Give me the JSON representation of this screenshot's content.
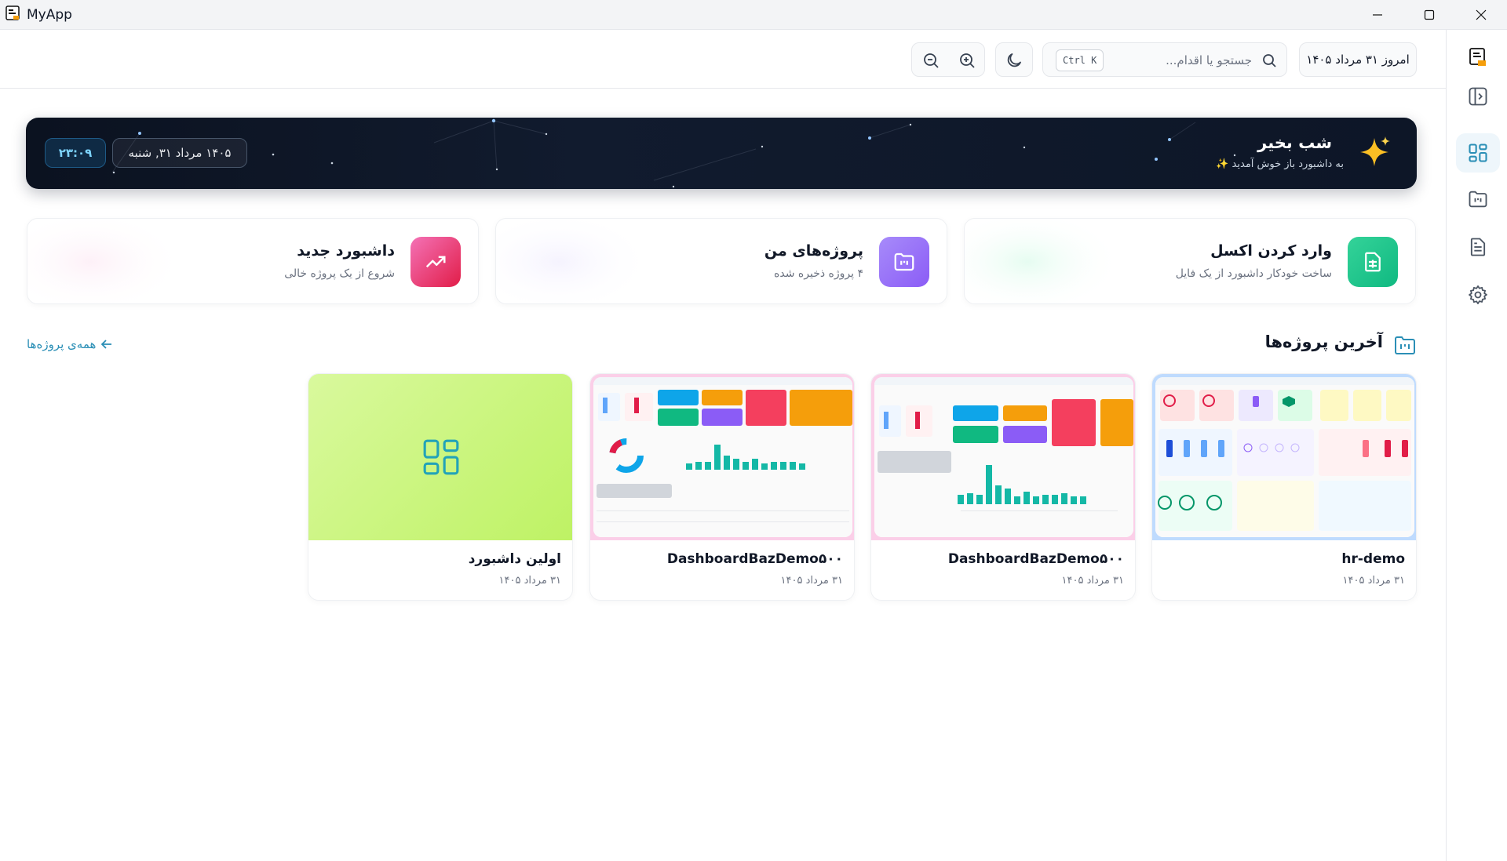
{
  "window": {
    "title": "MyApp",
    "icon": "app-logo-icon",
    "controls": [
      "minimize-icon",
      "maximize-icon",
      "close-icon"
    ]
  },
  "sidebar": {
    "items": [
      {
        "name": "logo",
        "icon": "app-logo-icon"
      },
      {
        "name": "toggle-sidebar",
        "icon": "sidebar-toggle-icon"
      },
      {
        "name": "dashboard",
        "icon": "grid-icon",
        "active": true
      },
      {
        "name": "projects",
        "icon": "folder-chart-icon"
      },
      {
        "name": "documents",
        "icon": "document-icon"
      },
      {
        "name": "settings",
        "icon": "gear-icon"
      }
    ]
  },
  "header": {
    "today": "امروز ۳۱ مرداد ۱۴۰۵",
    "search_placeholder": "جستجو یا اقدام...",
    "shortcut": "Ctrl K",
    "icons": [
      "zoom-out-icon",
      "zoom-in-icon",
      "moon-icon",
      "search-icon"
    ]
  },
  "banner": {
    "greeting": "شب بخیر",
    "welcome": "به داشبورد باز خوش آمدید ✨",
    "day": "۱۴۰۵ مرداد ۳۱, شنبه",
    "time": "۲۳:۰۹",
    "icon": "sparkle-icon"
  },
  "quick_actions": [
    {
      "title": "وارد کردن اکسل",
      "subtitle": "ساخت خودکار داشبورد از یک فایل",
      "icon": "spreadsheet-icon",
      "color": "#10b981"
    },
    {
      "title": "پروژه‌های من",
      "subtitle": "۴ پروژه ذخیره شده",
      "icon": "folder-chart-icon",
      "color": "#8b5cf6"
    },
    {
      "title": "داشبورد جدید",
      "subtitle": "شروع از یک پروژه خالی",
      "icon": "trend-up-icon",
      "color": "#ec4899"
    }
  ],
  "recent": {
    "title": "آخرین پروژه‌ها",
    "all_link": "همه‌ی پروژه‌ها",
    "projects": [
      {
        "name": "hr-demo",
        "date": "۳۱ مرداد ۱۴۰۵",
        "border": "#bfdbfe"
      },
      {
        "name": "DashboardBazDemo۵۰۰",
        "date": "۳۱ مرداد ۱۴۰۵",
        "border": "#fbcfe8"
      },
      {
        "name": "DashboardBazDemo۵۰۰",
        "date": "۳۱ مرداد ۱۴۰۵",
        "border": "#fbcfe8"
      },
      {
        "name": "اولین داشبورد",
        "date": "۳۱ مرداد ۱۴۰۵",
        "border": "#d9f99d"
      }
    ]
  }
}
